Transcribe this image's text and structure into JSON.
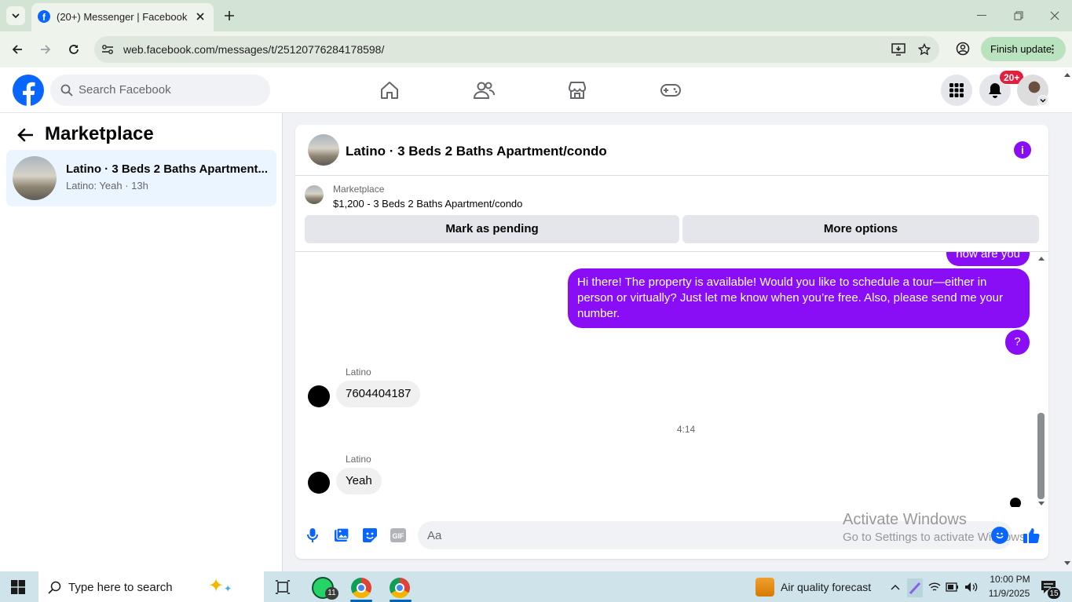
{
  "browser": {
    "tab_title": "(20+) Messenger | Facebook",
    "url": "web.facebook.com/messages/t/25120776284178598/",
    "finish_update_label": "Finish update"
  },
  "fb": {
    "search_placeholder": "Search Facebook",
    "notification_badge": "20+",
    "brand_color": "#0866ff"
  },
  "sidebar": {
    "title": "Marketplace",
    "chat": {
      "title": "Latino · 3 Beds 2 Baths Apartment...",
      "preview": "Latino: Yeah · 13h"
    }
  },
  "conversation": {
    "title": "Latino · 3 Beds 2 Baths Apartment/condo",
    "listing_label": "Marketplace",
    "listing_detail": "$1,200 - 3 Beds 2 Baths Apartment/condo",
    "mark_pending_label": "Mark as pending",
    "more_options_label": "More options",
    "accent": "#8a0ef5",
    "messages": [
      {
        "text": "how are you"
      },
      {
        "text": "Hi there! The property is available! Would you like to schedule a tour—either in person or virtually? Just let me know when you’re free. Also, please send me your number."
      },
      {
        "text": "?"
      },
      {
        "sender": "Latino",
        "text": "7604404187"
      },
      {
        "timestamp": "4:14"
      },
      {
        "sender": "Latino",
        "text": "Yeah"
      }
    ],
    "composer_placeholder": "Aa",
    "watermark_title": "Activate Windows",
    "watermark_sub": "Go to Settings to activate Windows."
  },
  "taskbar": {
    "search_placeholder": "Type here to search",
    "whatsapp_badge": "11",
    "weather": "Air quality forecast",
    "time": "10:00 PM",
    "date": "11/9/2025",
    "notif_count": "15"
  }
}
